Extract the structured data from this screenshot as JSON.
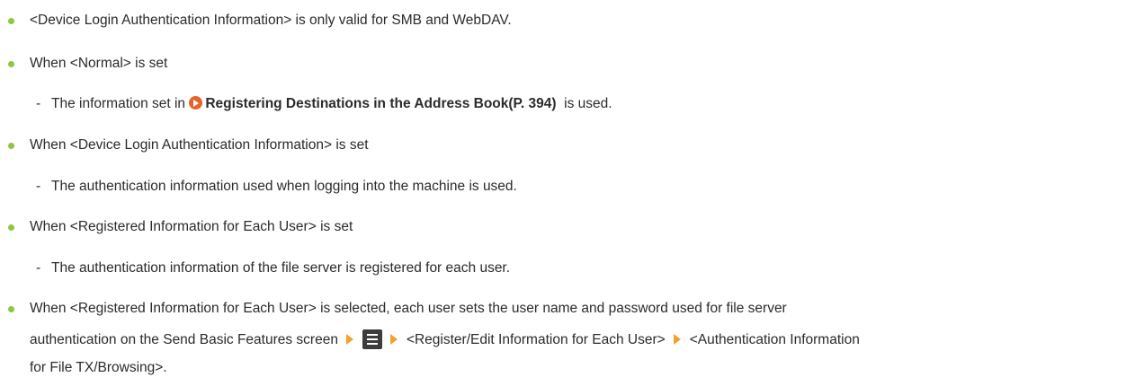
{
  "colors": {
    "bullet": "#8dc63f",
    "link_icon": "#e8632a",
    "arrow": "#f2a12b",
    "menu_key": "#3c3c3c",
    "text": "#2b2b2b"
  },
  "items": [
    {
      "text": "<Device Login Authentication Information> is only valid for SMB and WebDAV."
    },
    {
      "text": "When <Normal> is set"
    },
    {
      "sub_before": "The information set in",
      "sub_link": "Registering Destinations in the Address Book(P. 394)",
      "sub_after": "is used."
    },
    {
      "text": "When <Device Login Authentication Information> is set"
    },
    {
      "sub": "The authentication information used when logging into the machine is used."
    },
    {
      "text": "When <Registered Information for Each User> is set"
    },
    {
      "sub": "The authentication information of the file server is registered for each user."
    },
    {
      "line1": "When <Registered Information for Each User> is selected, each user sets the user name and password used for file server",
      "line2_a": "authentication on the Send Basic Features screen",
      "line2_b": "<Register/Edit Information for Each User>",
      "line2_c": "<Authentication Information",
      "line3": "for File TX/Browsing>."
    }
  ],
  "icons": {
    "link": "circle-play-icon",
    "arrow": "right-triangle-arrow-icon",
    "menu": "menu-key-icon"
  }
}
